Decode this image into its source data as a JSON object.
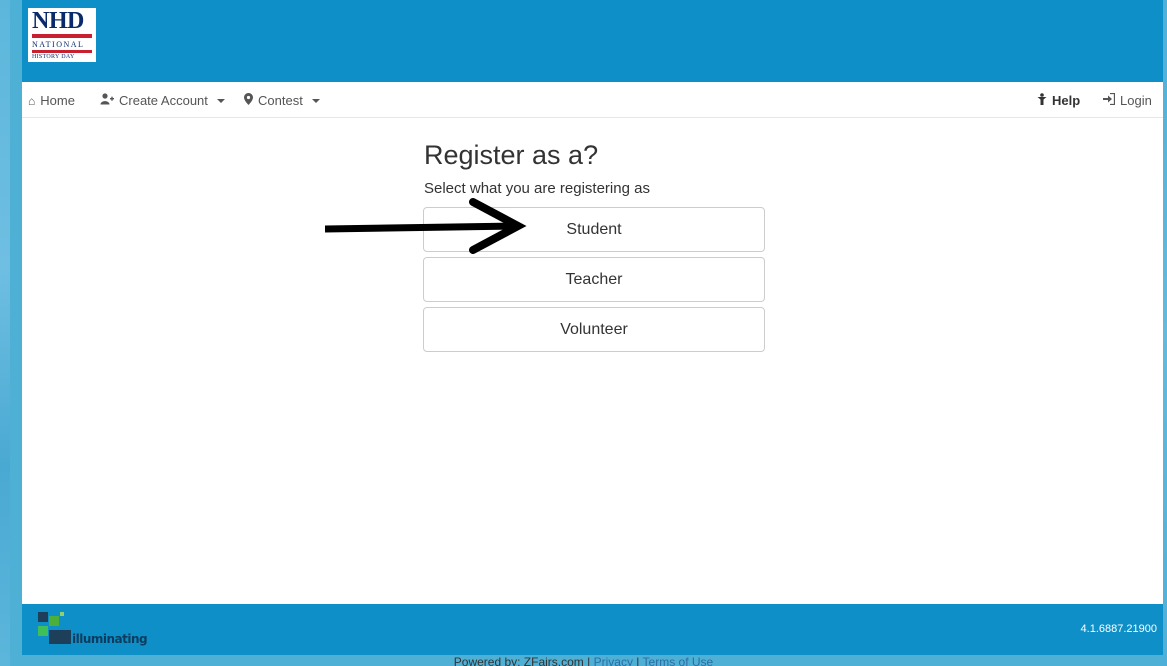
{
  "header": {
    "logo": {
      "main": "NHD",
      "line1": "NATIONAL",
      "line2": "HISTORY DAY"
    }
  },
  "navbar": {
    "home_label": "Home",
    "create_account_label": "Create Account",
    "contest_label": "Contest",
    "help_label": "Help",
    "login_label": "Login"
  },
  "main": {
    "title": "Register as a?",
    "subtitle": "Select what you are registering as",
    "roles": [
      "Student",
      "Teacher",
      "Volunteer"
    ]
  },
  "footer": {
    "logo_text": "illuminating",
    "version": "4.1.6887.21900",
    "powered_by": "Powered by: ZFairs.com |",
    "privacy_label": "Privacy",
    "separator": "|",
    "terms_label": "Terms of Use"
  },
  "colors": {
    "header_bg": "#0e8fc7",
    "accent_red": "#c8202f",
    "link_blue": "#2b6ea3"
  }
}
